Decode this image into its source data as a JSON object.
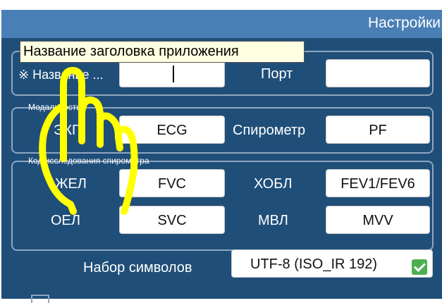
{
  "header": {
    "title": "Настройки"
  },
  "tooltip": "Название заголовка приложения",
  "app": {
    "name_label": "※ Название ...",
    "name_value": "",
    "port_label": "Порт",
    "port_value": ""
  },
  "modality": {
    "group_label": "Модальность",
    "ecg_label": "ЭКГ",
    "ecg_value": "ECG",
    "spiro_label": "Спирометр",
    "spiro_value": "PF"
  },
  "spirometry": {
    "group_label": "Код исследования спирометра",
    "zhel_label": "ЖЕЛ",
    "zhel_value": "FVC",
    "hobl_label": "ХОБЛ",
    "hobl_value": "FEV1/FEV6",
    "oel_label": "ОЕЛ",
    "oel_value": "SVC",
    "mvl_label": "МВЛ",
    "mvl_value": "MVV"
  },
  "charset": {
    "label": "Набор символов",
    "value": "UTF-8 (ISO_IR 192)",
    "checked": true
  },
  "overlay": {
    "cursor": "hand-pointer-icon",
    "color": "#ffff00"
  }
}
